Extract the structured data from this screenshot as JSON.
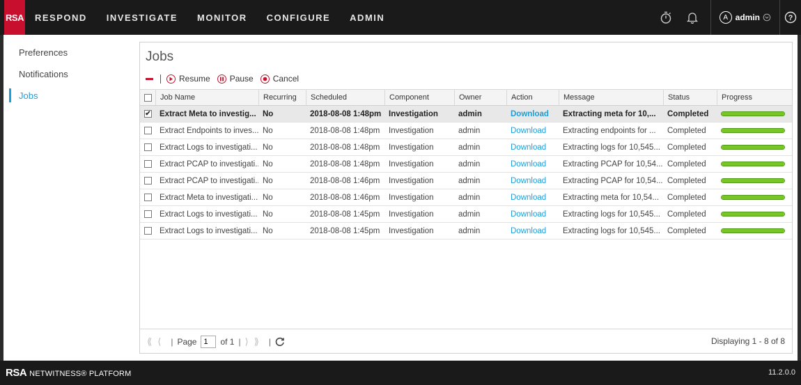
{
  "nav": {
    "logo": "RSA",
    "items": [
      "RESPOND",
      "INVESTIGATE",
      "MONITOR",
      "CONFIGURE",
      "ADMIN"
    ],
    "user": "admin",
    "user_initial": "A"
  },
  "sidebar": {
    "items": [
      {
        "label": "Preferences",
        "active": false
      },
      {
        "label": "Notifications",
        "active": false
      },
      {
        "label": "Jobs",
        "active": true
      }
    ]
  },
  "panel": {
    "title": "Jobs",
    "toolbar": {
      "resume": "Resume",
      "pause": "Pause",
      "cancel": "Cancel"
    }
  },
  "table": {
    "columns": [
      "Job Name",
      "Recurring",
      "Scheduled",
      "Component",
      "Owner",
      "Action",
      "Message",
      "Status",
      "Progress"
    ],
    "rows": [
      {
        "name": "Extract Meta to investig...",
        "recurring": "No",
        "scheduled": "2018-08-08 1:48pm",
        "component": "Investigation",
        "owner": "admin",
        "action": "Download",
        "message": "Extracting meta for 10,...",
        "status": "Completed",
        "progress": 100,
        "checked": true
      },
      {
        "name": "Extract Endpoints to inves...",
        "recurring": "No",
        "scheduled": "2018-08-08 1:48pm",
        "component": "Investigation",
        "owner": "admin",
        "action": "Download",
        "message": "Extracting endpoints for ...",
        "status": "Completed",
        "progress": 100,
        "checked": false
      },
      {
        "name": "Extract Logs to investigati...",
        "recurring": "No",
        "scheduled": "2018-08-08 1:48pm",
        "component": "Investigation",
        "owner": "admin",
        "action": "Download",
        "message": "Extracting logs for 10,545...",
        "status": "Completed",
        "progress": 100,
        "checked": false
      },
      {
        "name": "Extract PCAP to investigati...",
        "recurring": "No",
        "scheduled": "2018-08-08 1:48pm",
        "component": "Investigation",
        "owner": "admin",
        "action": "Download",
        "message": "Extracting PCAP for 10,54...",
        "status": "Completed",
        "progress": 100,
        "checked": false
      },
      {
        "name": "Extract PCAP to investigati...",
        "recurring": "No",
        "scheduled": "2018-08-08 1:46pm",
        "component": "Investigation",
        "owner": "admin",
        "action": "Download",
        "message": "Extracting PCAP for 10,54...",
        "status": "Completed",
        "progress": 100,
        "checked": false
      },
      {
        "name": "Extract Meta to investigati...",
        "recurring": "No",
        "scheduled": "2018-08-08 1:46pm",
        "component": "Investigation",
        "owner": "admin",
        "action": "Download",
        "message": "Extracting meta for 10,54...",
        "status": "Completed",
        "progress": 100,
        "checked": false
      },
      {
        "name": "Extract Logs to investigati...",
        "recurring": "No",
        "scheduled": "2018-08-08 1:45pm",
        "component": "Investigation",
        "owner": "admin",
        "action": "Download",
        "message": "Extracting logs for 10,545...",
        "status": "Completed",
        "progress": 100,
        "checked": false
      },
      {
        "name": "Extract Logs to investigati...",
        "recurring": "No",
        "scheduled": "2018-08-08 1:45pm",
        "component": "Investigation",
        "owner": "admin",
        "action": "Download",
        "message": "Extracting logs for 10,545...",
        "status": "Completed",
        "progress": 100,
        "checked": false
      }
    ]
  },
  "pager": {
    "page_label": "Page",
    "page_value": "1",
    "of_label": "of 1",
    "displaying": "Displaying 1 - 8 of 8"
  },
  "footer": {
    "brand_logo": "RSA",
    "brand_text": "NETWITNESS® PLATFORM",
    "version": "11.2.0.0"
  },
  "colors": {
    "accent": "#1a9fd8",
    "brand_red": "#c8102e",
    "progress_green": "#7cc520"
  }
}
